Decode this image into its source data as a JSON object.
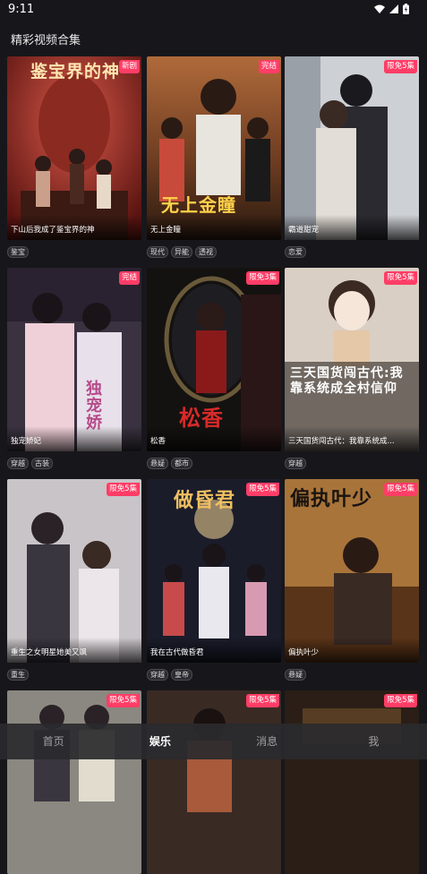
{
  "status": {
    "time": "9:11"
  },
  "page_title": "精彩视频合集",
  "cards": [
    {
      "caption": "下山后我成了鉴宝界的神",
      "badge": "新剧",
      "tags": [
        "鉴宝"
      ],
      "poster_text": "鉴宝界的神"
    },
    {
      "caption": "无上金瞳",
      "badge": "完结",
      "tags": [
        "现代",
        "异能",
        "透视"
      ],
      "poster_text": "无上金瞳"
    },
    {
      "caption": "霸道甜宠",
      "badge": "限免5集",
      "tags": [
        "恋爱"
      ],
      "poster_text": ""
    },
    {
      "caption": "独宠娇妃",
      "badge": "完结",
      "tags": [
        "穿越",
        "古装"
      ],
      "poster_text": "独宠娇"
    },
    {
      "caption": "松香",
      "badge": "限免3集",
      "tags": [
        "悬疑",
        "都市"
      ],
      "poster_text": "松香"
    },
    {
      "caption": "三天国货闯古代：我靠系统成...",
      "badge": "限免5集",
      "tags": [
        "穿越"
      ],
      "poster_text": "三天国货闯古代:我靠系统成全村信仰"
    },
    {
      "caption": "重生之女明星她美又飒",
      "badge": "限免5集",
      "tags": [
        "重生"
      ],
      "poster_text": ""
    },
    {
      "caption": "我在古代做昏君",
      "badge": "限免5集",
      "tags": [
        "穿越",
        "皇帝"
      ],
      "poster_text": "做昏君"
    },
    {
      "caption": "偏执叶少",
      "badge": "限免5集",
      "tags": [
        "悬疑"
      ],
      "poster_text": "偏执叶少"
    },
    {
      "caption": "",
      "badge": "限免5集",
      "tags": [],
      "poster_text": ""
    },
    {
      "caption": "",
      "badge": "限免5集",
      "tags": [],
      "poster_text": ""
    },
    {
      "caption": "",
      "badge": "限免5集",
      "tags": [],
      "poster_text": ""
    }
  ],
  "nav": {
    "home": "首页",
    "entertainment": "娱乐",
    "messages": "消息",
    "me": "我"
  }
}
